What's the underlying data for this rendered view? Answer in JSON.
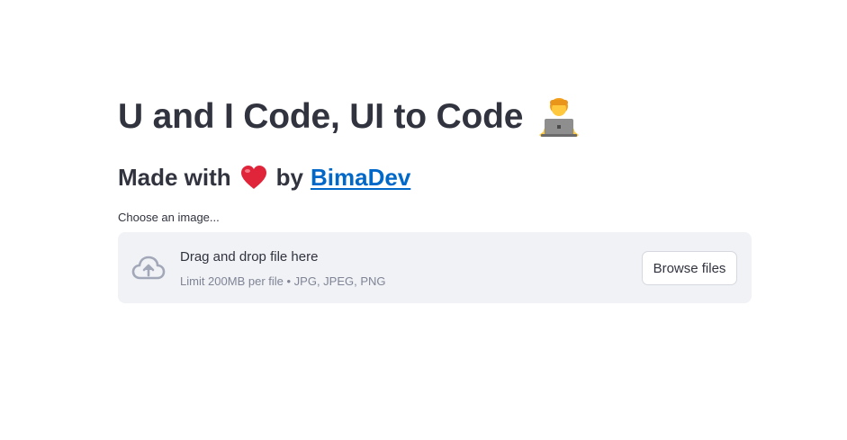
{
  "header": {
    "title": "U and I Code, UI to Code",
    "title_emoji_icon": "technologist-emoji-icon"
  },
  "subtitle": {
    "prefix": "Made with",
    "heart_icon": "red-heart-icon",
    "by": "by",
    "author_link": "BimaDev",
    "link_color": "#0068c9"
  },
  "uploader": {
    "label": "Choose an image...",
    "icon": "cloud-upload-icon",
    "dropzone_title": "Drag and drop file here",
    "dropzone_limit": "Limit 200MB per file • JPG, JPEG, PNG",
    "browse_button": "Browse files",
    "dropzone_bg": "#f0f2f6"
  }
}
